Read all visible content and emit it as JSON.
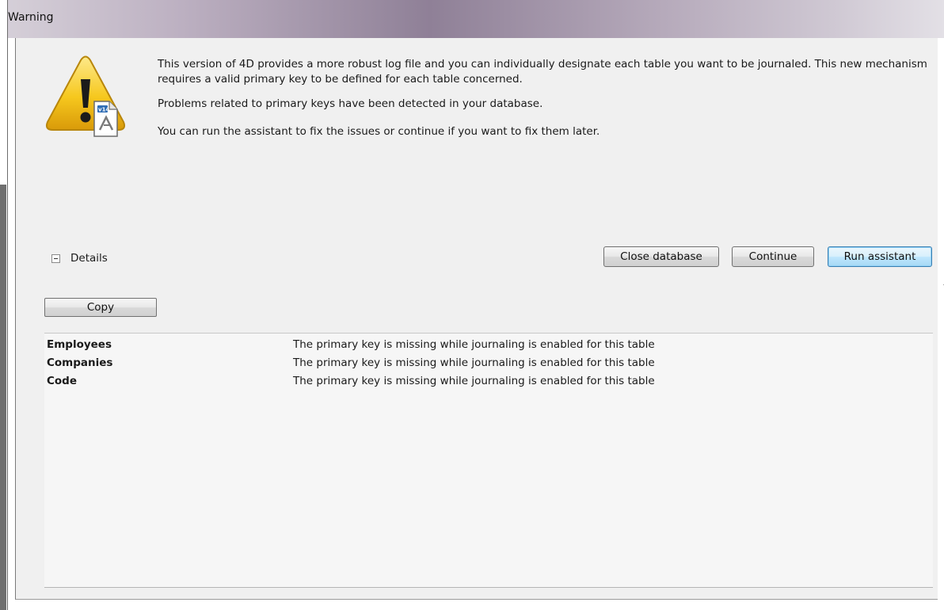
{
  "window": {
    "title": "Warning"
  },
  "message": {
    "p1": "This version of 4D provides a more robust log file and you can individually designate each table you want to be journaled. This new mechanism requires a valid primary key to be defined for each table concerned.",
    "p2": "Problems related to primary keys have been detected in your database.",
    "p3": "You can run the assistant to fix the issues or continue if you want to fix them later."
  },
  "details": {
    "label": "Details",
    "expanded": true
  },
  "buttons": {
    "close_database": "Close database",
    "continue": "Continue",
    "run_assistant": "Run assistant",
    "copy": "Copy"
  },
  "issues": [
    {
      "table": "Employees",
      "problem": "The primary key is missing while journaling is enabled for this table"
    },
    {
      "table": "Companies",
      "problem": "The primary key is missing while journaling is enabled for this table"
    },
    {
      "table": "Code",
      "problem": "The primary key is missing while journaling is enabled for this table"
    }
  ],
  "icons": {
    "warning": "warning-triangle-icon",
    "document": "database-document-icon"
  },
  "colors": {
    "default_button_border": "#3c7fb1",
    "warning_yellow": "#f2c21b"
  }
}
